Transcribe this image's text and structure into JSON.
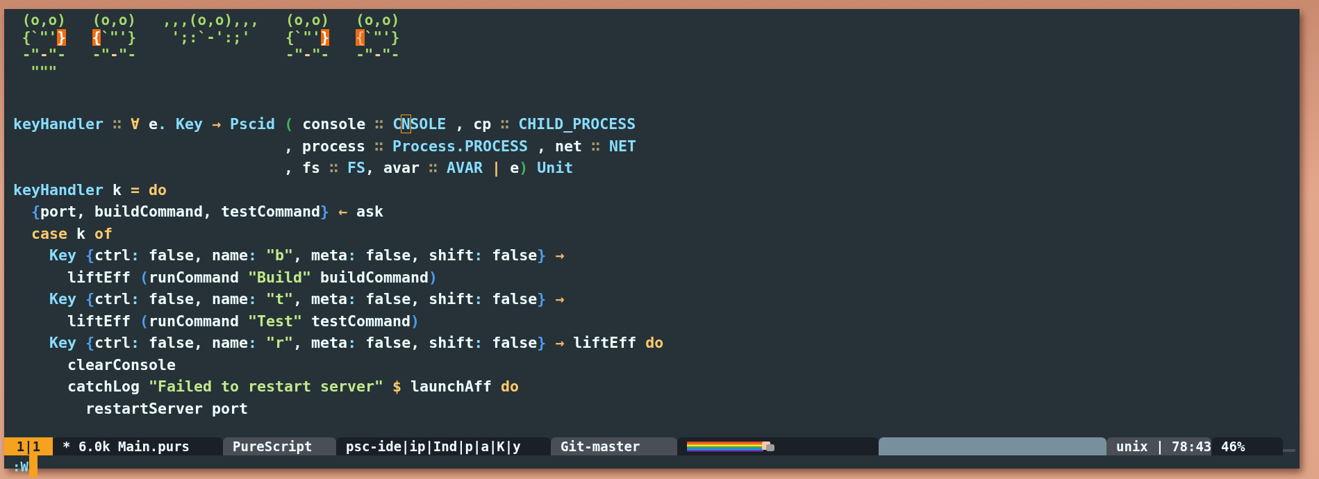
{
  "ascii_art": [
    [
      {
        "kind": "art",
        "text": " (o,o)   (o,o)   ,,,(o,o),,,   (o,o)   (o,o)"
      }
    ],
    [
      {
        "kind": "art",
        "text": " {`\"'"
      },
      {
        "kind": "hl",
        "text": "}   "
      },
      {
        "kind": "hl",
        "text": "{"
      },
      {
        "kind": "art",
        "text": "`\"'}    ';:`-':;'    {`\"'"
      },
      {
        "kind": "hl",
        "text": "}   "
      },
      {
        "kind": "hl-faint",
        "text": "{"
      },
      {
        "kind": "art",
        "text": "`\"'}"
      }
    ],
    [
      {
        "kind": "art",
        "text": " -\""
      },
      {
        "kind": "peach",
        "text": "-"
      },
      {
        "kind": "art",
        "text": "\"-   -\""
      },
      {
        "kind": "peach",
        "text": "-"
      },
      {
        "kind": "art",
        "text": "\"-                 -\""
      },
      {
        "kind": "peach",
        "text": "-"
      },
      {
        "kind": "art",
        "text": "\"-   -\""
      },
      {
        "kind": "peach",
        "text": "-"
      },
      {
        "kind": "art",
        "text": "\"-"
      }
    ],
    [
      {
        "kind": "art",
        "text": "  \"\"\""
      }
    ]
  ],
  "code": [
    [
      {
        "kind": "type",
        "text": "keyHandler"
      },
      {
        "kind": "dim",
        "text": " ∷ "
      },
      {
        "kind": "kw",
        "text": "∀"
      },
      {
        "kind": "plain",
        "text": " e"
      },
      {
        "kind": "punct",
        "text": "."
      },
      {
        "kind": "type",
        "text": " Key"
      },
      {
        "kind": "op",
        "text": " → "
      },
      {
        "kind": "type",
        "text": "Pscid"
      },
      {
        "kind": "paren",
        "text": " ("
      },
      {
        "kind": "plain",
        "text": " console "
      },
      {
        "kind": "dim",
        "text": "∷"
      },
      {
        "kind": "type",
        "text": " C"
      },
      {
        "kind": "cursor",
        "text": "N"
      },
      {
        "kind": "type",
        "text": "SOLE"
      },
      {
        "kind": "plain",
        "text": " , cp "
      },
      {
        "kind": "dim",
        "text": "∷"
      },
      {
        "kind": "type",
        "text": " CHILD_PROCESS"
      }
    ],
    [
      {
        "kind": "plain",
        "text": "                              , process "
      },
      {
        "kind": "dim",
        "text": "∷"
      },
      {
        "kind": "type",
        "text": " Process.PROCESS"
      },
      {
        "kind": "plain",
        "text": " , net "
      },
      {
        "kind": "dim",
        "text": "∷"
      },
      {
        "kind": "type",
        "text": " NET"
      }
    ],
    [
      {
        "kind": "plain",
        "text": "                              , fs "
      },
      {
        "kind": "dim",
        "text": "∷"
      },
      {
        "kind": "type",
        "text": " FS"
      },
      {
        "kind": "plain",
        "text": ", avar "
      },
      {
        "kind": "dim",
        "text": "∷"
      },
      {
        "kind": "type",
        "text": " AVAR"
      },
      {
        "kind": "kw",
        "text": " | "
      },
      {
        "kind": "plain",
        "text": "e"
      },
      {
        "kind": "paren",
        "text": ")"
      },
      {
        "kind": "type",
        "text": " Unit"
      }
    ],
    [
      {
        "kind": "type",
        "text": "keyHandler"
      },
      {
        "kind": "plain",
        "text": " k "
      },
      {
        "kind": "kw",
        "text": "="
      },
      {
        "kind": "kw",
        "text": " do"
      }
    ],
    [
      {
        "kind": "brace",
        "text": "  {"
      },
      {
        "kind": "plain",
        "text": "port, buildCommand, testCommand"
      },
      {
        "kind": "brace",
        "text": "}"
      },
      {
        "kind": "op",
        "text": " ← "
      },
      {
        "kind": "plain",
        "text": "ask"
      }
    ],
    [
      {
        "kind": "kw",
        "text": "  case"
      },
      {
        "kind": "plain",
        "text": " k "
      },
      {
        "kind": "kw",
        "text": "of"
      }
    ],
    [
      {
        "kind": "type",
        "text": "    Key"
      },
      {
        "kind": "brace",
        "text": " {"
      },
      {
        "kind": "plain",
        "text": "ctrl"
      },
      {
        "kind": "punct",
        "text": ":"
      },
      {
        "kind": "plain",
        "text": " false, name"
      },
      {
        "kind": "punct",
        "text": ":"
      },
      {
        "kind": "str",
        "text": " \"b\""
      },
      {
        "kind": "plain",
        "text": ", meta"
      },
      {
        "kind": "punct",
        "text": ":"
      },
      {
        "kind": "plain",
        "text": " false, shift"
      },
      {
        "kind": "punct",
        "text": ":"
      },
      {
        "kind": "plain",
        "text": " false"
      },
      {
        "kind": "brace",
        "text": "}"
      },
      {
        "kind": "op",
        "text": " →"
      }
    ],
    [
      {
        "kind": "plain",
        "text": "      liftEff "
      },
      {
        "kind": "brace",
        "text": "("
      },
      {
        "kind": "plain",
        "text": "runCommand "
      },
      {
        "kind": "str",
        "text": "\"Build\""
      },
      {
        "kind": "plain",
        "text": " buildCommand"
      },
      {
        "kind": "brace",
        "text": ")"
      }
    ],
    [
      {
        "kind": "type",
        "text": "    Key"
      },
      {
        "kind": "brace",
        "text": " {"
      },
      {
        "kind": "plain",
        "text": "ctrl"
      },
      {
        "kind": "punct",
        "text": ":"
      },
      {
        "kind": "plain",
        "text": " false, name"
      },
      {
        "kind": "punct",
        "text": ":"
      },
      {
        "kind": "str",
        "text": " \"t\""
      },
      {
        "kind": "plain",
        "text": ", meta"
      },
      {
        "kind": "punct",
        "text": ":"
      },
      {
        "kind": "plain",
        "text": " false, shift"
      },
      {
        "kind": "punct",
        "text": ":"
      },
      {
        "kind": "plain",
        "text": " false"
      },
      {
        "kind": "brace",
        "text": "}"
      },
      {
        "kind": "op",
        "text": " →"
      }
    ],
    [
      {
        "kind": "plain",
        "text": "      liftEff "
      },
      {
        "kind": "brace",
        "text": "("
      },
      {
        "kind": "plain",
        "text": "runCommand "
      },
      {
        "kind": "str",
        "text": "\"Test\""
      },
      {
        "kind": "plain",
        "text": " testCommand"
      },
      {
        "kind": "brace",
        "text": ")"
      }
    ],
    [
      {
        "kind": "type",
        "text": "    Key"
      },
      {
        "kind": "brace",
        "text": " {"
      },
      {
        "kind": "plain",
        "text": "ctrl"
      },
      {
        "kind": "punct",
        "text": ":"
      },
      {
        "kind": "plain",
        "text": " false, name"
      },
      {
        "kind": "punct",
        "text": ":"
      },
      {
        "kind": "str",
        "text": " \"r\""
      },
      {
        "kind": "plain",
        "text": ", meta"
      },
      {
        "kind": "punct",
        "text": ":"
      },
      {
        "kind": "plain",
        "text": " false, shift"
      },
      {
        "kind": "punct",
        "text": ":"
      },
      {
        "kind": "plain",
        "text": " false"
      },
      {
        "kind": "brace",
        "text": "}"
      },
      {
        "kind": "op",
        "text": " → "
      },
      {
        "kind": "plain",
        "text": "liftEff "
      },
      {
        "kind": "kw",
        "text": "do"
      }
    ],
    [
      {
        "kind": "plain",
        "text": "      clearConsole"
      }
    ],
    [
      {
        "kind": "plain",
        "text": "      catchLog "
      },
      {
        "kind": "str",
        "text": "\"Failed to restart server\""
      },
      {
        "kind": "kw",
        "text": " $ "
      },
      {
        "kind": "plain",
        "text": "launchAff "
      },
      {
        "kind": "kw",
        "text": "do"
      }
    ],
    [
      {
        "kind": "plain",
        "text": "        restartServer port"
      }
    ]
  ],
  "status_bar": [
    {
      "kind": "mode",
      "text": "1|1"
    },
    {
      "kind": "file",
      "text": "* 6.0k Main.purs"
    },
    {
      "kind": "filetype",
      "text": "PureScript"
    },
    {
      "kind": "plugins",
      "text": "psc-ide|ip|Ind|p|a|K|y"
    },
    {
      "kind": "branch",
      "text": "Git-master"
    },
    {
      "kind": "nyan"
    },
    {
      "kind": "filler"
    },
    {
      "kind": "format",
      "text": "unix | 78:43"
    },
    {
      "kind": "percent",
      "text": "46%"
    },
    {
      "kind": "edge"
    }
  ],
  "command_line": {
    "text": ":W"
  }
}
